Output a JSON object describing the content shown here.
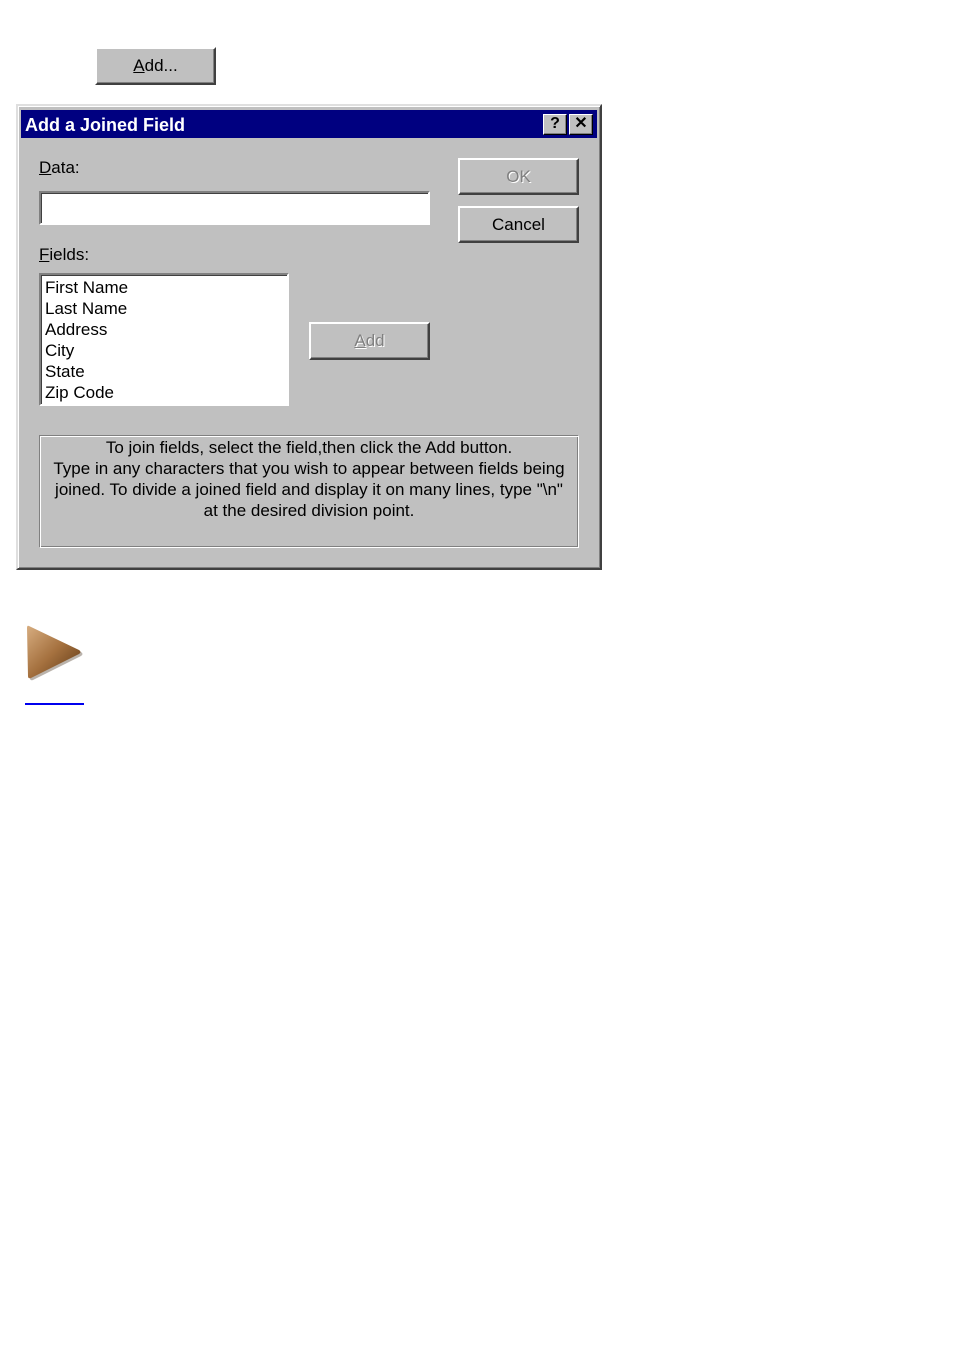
{
  "top_button": {
    "label_accel": "A",
    "label_rest": "dd..."
  },
  "dialog": {
    "title": "Add a Joined Field",
    "help_glyph": "?",
    "close_glyph": "✕",
    "data_label_accel": "D",
    "data_label_rest": "ata:",
    "data_value": "",
    "fields_label_accel": "F",
    "fields_label_rest": "ields:",
    "fields": [
      "First Name",
      "Last Name",
      "Address",
      "City",
      "State",
      "Zip Code"
    ],
    "ok_label": "OK",
    "ok_enabled": false,
    "cancel_label": "Cancel",
    "add_label_accel": "A",
    "add_label_rest": "dd",
    "add_enabled": false,
    "info_lines": [
      "To join fields, select the field,then click the Add button.",
      "Type in any characters that you wish to appear between fields being",
      "joined.  To divide a joined field and display it on many lines, type \"\\n\"",
      "at the desired division point."
    ]
  },
  "navigation": {
    "next_icon": "play-arrow-icon",
    "link_text": ""
  },
  "colors": {
    "titlebar": "#000080",
    "dialog_face": "#c0c0c0",
    "link": "#0000ee",
    "arrow": "#8b5a2b"
  }
}
